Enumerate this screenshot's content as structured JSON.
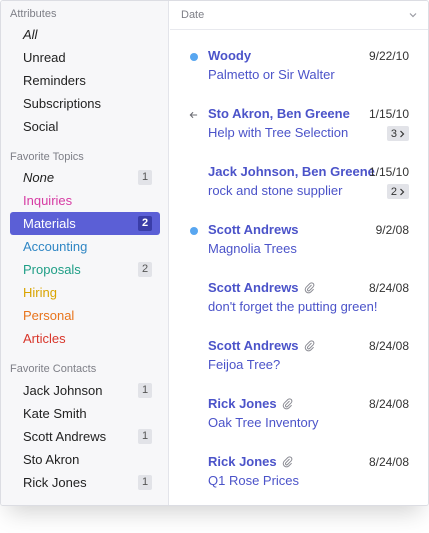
{
  "sidebar": {
    "attributes": {
      "heading": "Attributes",
      "items": [
        {
          "label": "All",
          "italic": true
        },
        {
          "label": "Unread"
        },
        {
          "label": "Reminders"
        },
        {
          "label": "Subscriptions"
        },
        {
          "label": "Social"
        }
      ]
    },
    "topics": {
      "heading": "Favorite Topics",
      "items": [
        {
          "label": "None",
          "italic": true,
          "count": "1",
          "color": "#222222"
        },
        {
          "label": "Inquiries",
          "color": "#d63ba3"
        },
        {
          "label": "Materials",
          "count": "2",
          "selected": true,
          "color": "#ffffff"
        },
        {
          "label": "Accounting",
          "color": "#2f86c4"
        },
        {
          "label": "Proposals",
          "count": "2",
          "color": "#1f9e86"
        },
        {
          "label": "Hiring",
          "color": "#d9a400"
        },
        {
          "label": "Personal",
          "color": "#e8741c"
        },
        {
          "label": "Articles",
          "color": "#d8362b"
        }
      ]
    },
    "contacts": {
      "heading": "Favorite Contacts",
      "items": [
        {
          "label": "Jack Johnson",
          "count": "1"
        },
        {
          "label": "Kate Smith"
        },
        {
          "label": "Scott Andrews",
          "count": "1"
        },
        {
          "label": "Sto Akron"
        },
        {
          "label": "Rick Jones",
          "count": "1"
        }
      ]
    }
  },
  "list": {
    "sort_label": "Date",
    "sort_icon": "chevron-down-icon",
    "messages": [
      {
        "sender": "Woody",
        "date": "9/22/10",
        "subject": "Palmetto or Sir Walter",
        "status": "unread"
      },
      {
        "sender": "Sto Akron, Ben Greene",
        "date": "1/15/10",
        "subject": "Help with Tree Selection",
        "status": "replied",
        "thread_count": "3"
      },
      {
        "sender": "Jack Johnson, Ben Greene",
        "date": "1/15/10",
        "subject": "rock and stone supplier",
        "thread_count": "2"
      },
      {
        "sender": "Scott Andrews",
        "date": "9/2/08",
        "subject": "Magnolia Trees",
        "status": "unread"
      },
      {
        "sender": "Scott Andrews",
        "date": "8/24/08",
        "subject": "don't forget the putting green!",
        "attachment": true
      },
      {
        "sender": "Scott Andrews",
        "date": "8/24/08",
        "subject": "Feijoa Tree?",
        "attachment": true
      },
      {
        "sender": "Rick Jones",
        "date": "8/24/08",
        "subject": "Oak Tree Inventory",
        "attachment": true
      },
      {
        "sender": "Rick Jones",
        "date": "8/24/08",
        "subject": "Q1 Rose Prices",
        "attachment": true
      }
    ]
  },
  "colors": {
    "accent": "#5b5fd6",
    "link": "#4b53c9",
    "unread_dot": "#58a6f0"
  }
}
